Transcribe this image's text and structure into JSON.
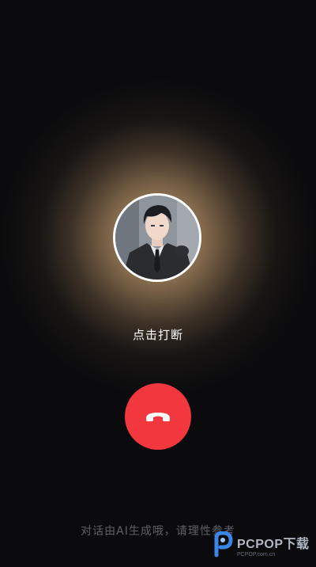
{
  "call": {
    "hint": "点击打断",
    "footer_note": "对话由AI生成哦，请理性参考"
  },
  "watermark": {
    "main": "PCPOP下载",
    "sub": "PCPOP.com.cn"
  },
  "icons": {
    "hangup": "phone-hangup-icon",
    "avatar": "character-portrait",
    "watermark": "pcpop-logo-icon"
  },
  "colors": {
    "hangup_button": "#f2373f",
    "background": "#0b0b0d",
    "glow": "#c6a476"
  }
}
